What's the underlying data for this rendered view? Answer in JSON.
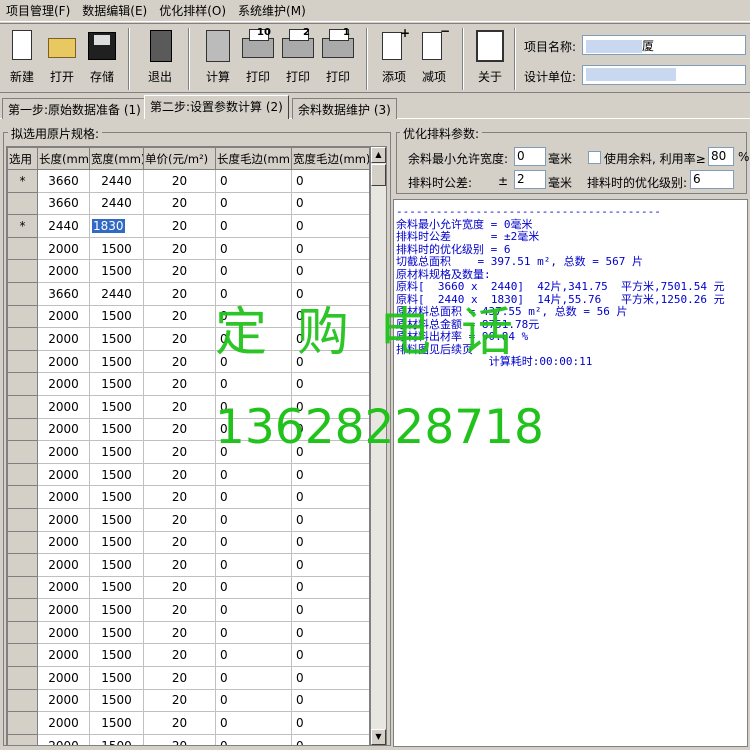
{
  "menu": [
    "项目管理(F)",
    "数据编辑(E)",
    "优化排样(O)",
    "系统维护(M)"
  ],
  "toolbar": {
    "new": "新建",
    "open": "打开",
    "save": "存储",
    "exit": "退出",
    "calc": "计算",
    "print1": "打印",
    "print2": "打印",
    "print3": "打印",
    "print1_num": "10",
    "print2_num": "2",
    "print3_num": "1",
    "add": "添项",
    "remove": "减项",
    "about": "关于"
  },
  "project": {
    "name_label": "项目名称:",
    "name_value": "厦",
    "unit_label": "设计单位:",
    "unit_value": ""
  },
  "tabs": [
    "第一步:原始数据准备 (1)",
    "第二步:设置参数计算 (2)",
    "余料数据维护 (3)"
  ],
  "left_group": {
    "title": "拟选用原片规格:",
    "columns": [
      "选用",
      "长度(mm)",
      "宽度(mm)",
      "单价(元/m²)",
      "长度毛边(mm)",
      "宽度毛边(mm)"
    ],
    "rows": [
      [
        "*",
        "3660",
        "2440",
        "20",
        "0",
        "0"
      ],
      [
        "",
        "3660",
        "2440",
        "20",
        "0",
        "0"
      ],
      [
        "*",
        "2440",
        "1830",
        "20",
        "0",
        "0"
      ],
      [
        "",
        "2000",
        "1500",
        "20",
        "0",
        "0"
      ],
      [
        "",
        "2000",
        "1500",
        "20",
        "0",
        "0"
      ],
      [
        "",
        "3660",
        "2440",
        "20",
        "0",
        "0"
      ],
      [
        "",
        "2000",
        "1500",
        "20",
        "0",
        "0"
      ],
      [
        "",
        "2000",
        "1500",
        "20",
        "0",
        "0"
      ],
      [
        "",
        "2000",
        "1500",
        "20",
        "0",
        "0"
      ],
      [
        "",
        "2000",
        "1500",
        "20",
        "0",
        "0"
      ],
      [
        "",
        "2000",
        "1500",
        "20",
        "0",
        "0"
      ],
      [
        "",
        "2000",
        "1500",
        "20",
        "0",
        "0"
      ],
      [
        "",
        "2000",
        "1500",
        "20",
        "0",
        "0"
      ],
      [
        "",
        "2000",
        "1500",
        "20",
        "0",
        "0"
      ],
      [
        "",
        "2000",
        "1500",
        "20",
        "0",
        "0"
      ],
      [
        "",
        "2000",
        "1500",
        "20",
        "0",
        "0"
      ],
      [
        "",
        "2000",
        "1500",
        "20",
        "0",
        "0"
      ],
      [
        "",
        "2000",
        "1500",
        "20",
        "0",
        "0"
      ],
      [
        "",
        "2000",
        "1500",
        "20",
        "0",
        "0"
      ],
      [
        "",
        "2000",
        "1500",
        "20",
        "0",
        "0"
      ],
      [
        "",
        "2000",
        "1500",
        "20",
        "0",
        "0"
      ],
      [
        "",
        "2000",
        "1500",
        "20",
        "0",
        "0"
      ],
      [
        "",
        "2000",
        "1500",
        "20",
        "0",
        "0"
      ],
      [
        "",
        "2000",
        "1500",
        "20",
        "0",
        "0"
      ],
      [
        "",
        "2000",
        "1500",
        "20",
        "0",
        "0"
      ],
      [
        "",
        "2000",
        "1500",
        "20",
        "0",
        "0"
      ]
    ],
    "selected_cell": "1830"
  },
  "params": {
    "title": "优化排料参数:",
    "min_remnant_label": "余料最小允许宽度:",
    "min_remnant_value": "0",
    "min_remnant_unit": "毫米",
    "use_remnant_label": "使用余料, 利用率≥",
    "use_remnant_value": "80",
    "use_remnant_unit": "%",
    "tolerance_label": "排料时公差:",
    "tolerance_sign": "±",
    "tolerance_value": "2",
    "tolerance_unit": "毫米",
    "level_label": "排料时的优化级别:",
    "level_value": "6"
  },
  "result_lines": [
    "----------------------------------------",
    "余料最小允许宽度 = 0毫米",
    "排料时公差      = ±2毫米",
    "排料时的优化级别 = 6",
    "切截总面积    = 397.51 m², 总数 = 567 片",
    "原材料规格及数量:",
    "原料[  3660 x  2440]  42片,341.75  平方米,7501.54 元",
    "原料[  2440 x  1830]  14片,55.76   平方米,1250.26 元",
    "原材料总面积 = 437.55 m², 总数 = 56 片",
    "原材料总金额 = 8751.78元",
    "原材料出材率 = 90.84 %",
    "排料图见后续页",
    "              计算耗时:00:00:11"
  ],
  "watermark": {
    "line1": "定购电话",
    "line2": "13628228718"
  }
}
